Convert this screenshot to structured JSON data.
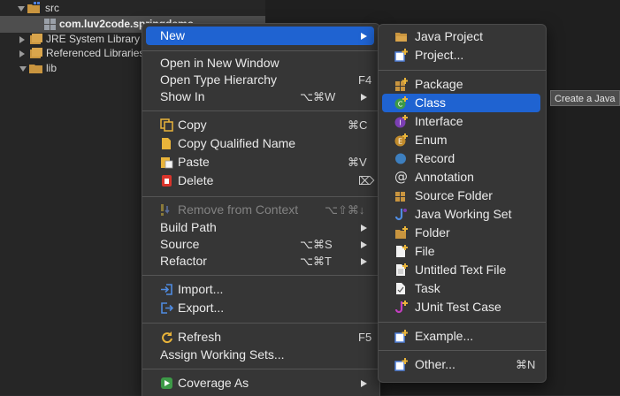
{
  "tree": {
    "items": [
      {
        "label": "src"
      },
      {
        "label": "com.luv2code.springdemo"
      },
      {
        "label": "JRE System Library ["
      },
      {
        "label": "Referenced Libraries"
      },
      {
        "label": "lib"
      }
    ]
  },
  "context_menu": {
    "new": {
      "label": "New"
    },
    "open_new_window": {
      "label": "Open in New Window"
    },
    "open_type_hierarchy": {
      "label": "Open Type Hierarchy",
      "shortcut": "F4"
    },
    "show_in": {
      "label": "Show In",
      "shortcut": "⌥⌘W"
    },
    "copy": {
      "label": "Copy",
      "shortcut": "⌘C"
    },
    "copy_qualified": {
      "label": "Copy Qualified Name"
    },
    "paste": {
      "label": "Paste",
      "shortcut": "⌘V"
    },
    "delete": {
      "label": "Delete",
      "shortcut": "⌦"
    },
    "remove_context": {
      "label": "Remove from Context",
      "shortcut": "⌥⇧⌘↓"
    },
    "build_path": {
      "label": "Build Path"
    },
    "source": {
      "label": "Source",
      "shortcut": "⌥⌘S"
    },
    "refactor": {
      "label": "Refactor",
      "shortcut": "⌥⌘T"
    },
    "import": {
      "label": "Import..."
    },
    "export": {
      "label": "Export..."
    },
    "refresh": {
      "label": "Refresh",
      "shortcut": "F5"
    },
    "assign_working_sets": {
      "label": "Assign Working Sets..."
    },
    "coverage_as": {
      "label": "Coverage As"
    }
  },
  "new_submenu": {
    "java_project": "Java Project",
    "project": "Project...",
    "package": "Package",
    "class": "Class",
    "interface": "Interface",
    "enum": "Enum",
    "record": "Record",
    "annotation": "Annotation",
    "source_folder": "Source Folder",
    "java_working_set": "Java Working Set",
    "folder": "Folder",
    "file": "File",
    "untitled_text_file": "Untitled Text File",
    "task": "Task",
    "junit_test_case": "JUnit Test Case",
    "example": "Example...",
    "other": "Other...",
    "other_shortcut": "⌘N"
  },
  "tooltip": {
    "text": "Create a Java"
  },
  "colors": {
    "highlight": "#1f63d1",
    "menu_bg": "#363636"
  }
}
